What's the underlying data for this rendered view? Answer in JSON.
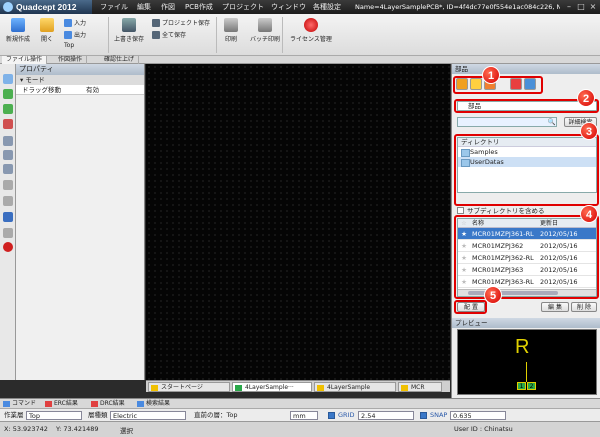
{
  "app": {
    "name": "Quadcept 2012"
  },
  "menu": [
    "ファイル",
    "編集",
    "作図",
    "PCB作成",
    "プロジェクト",
    "ウィンドウ",
    "各種設定"
  ],
  "window_title": "Name=4LayerSamplePCB*, ID=4f4dc77e0f554e1ac084c226, Nod···",
  "ribbon": {
    "new": "新規作成",
    "open": "開く",
    "input": "入力",
    "output": "出力",
    "top": "Top",
    "overwrite": "上書き保存",
    "save_project": "プロジェクト保存",
    "save_all": "全て保存",
    "print": "印刷",
    "batch_print": "バッチ印刷",
    "license": "ライセンス管理"
  },
  "ribbon_tabs": [
    "ファイル操作",
    "作図操作",
    "確認仕上げ"
  ],
  "property": {
    "title": "プロパティ",
    "group": "モード",
    "row_label": "ドラッグ移動",
    "row_value": "有効"
  },
  "doc_tabs": [
    "スタートページ",
    "4LayerSample···",
    "4LayerSample",
    "MCR"
  ],
  "parts": {
    "title": "部品",
    "category": "部品",
    "detail_button": "詳細検索",
    "directory_header": "ディレクトリ",
    "directories": [
      "Samples",
      "UserDatas"
    ],
    "subdir_label": "サブディレクトリを含める",
    "list_headers": [
      "☆",
      "名称",
      "更新日"
    ],
    "list_rows": [
      {
        "name": "MCR01MZPJ361-RL",
        "date": "2012/05/16",
        "selected": true
      },
      {
        "name": "MCR01MZPJ362",
        "date": "2012/05/16",
        "selected": false
      },
      {
        "name": "MCR01MZPJ362-RL",
        "date": "2012/05/16",
        "selected": false
      },
      {
        "name": "MCR01MZPJ363",
        "date": "2012/05/16",
        "selected": false
      },
      {
        "name": "MCR01MZPJ363-RL",
        "date": "2012/05/16",
        "selected": false
      }
    ],
    "place_button": "配 置",
    "edit_button": "編 集",
    "delete_button": "削 除"
  },
  "preview": {
    "title": "プレビュー",
    "symbol_letter": "R",
    "pin_labels": [
      "1",
      "2"
    ]
  },
  "callouts": [
    "1",
    "2",
    "3",
    "4",
    "5"
  ],
  "cmd_tabs": [
    "コマンド",
    "ERC結果",
    "DRC結果",
    "検索結果"
  ],
  "layerbar": {
    "layer_label": "作業層",
    "layer_value": "Top",
    "type_label": "層種類",
    "type_value": "Electric",
    "current_layer": "直前の層：Top",
    "unit": "mm",
    "grid_label": "GRID",
    "grid_value": "2.54",
    "snap_label": "SNAP",
    "snap_value": "0.635"
  },
  "status": {
    "x": "X: 53.923742",
    "y": "Y: 73.421489",
    "mode": "選択",
    "user": "User ID : Chinatsu"
  },
  "colors": {
    "accent": "#3a78c8",
    "callout": "#e00000",
    "preview_symbol": "#e0d000",
    "pin": "#2aa84a"
  }
}
